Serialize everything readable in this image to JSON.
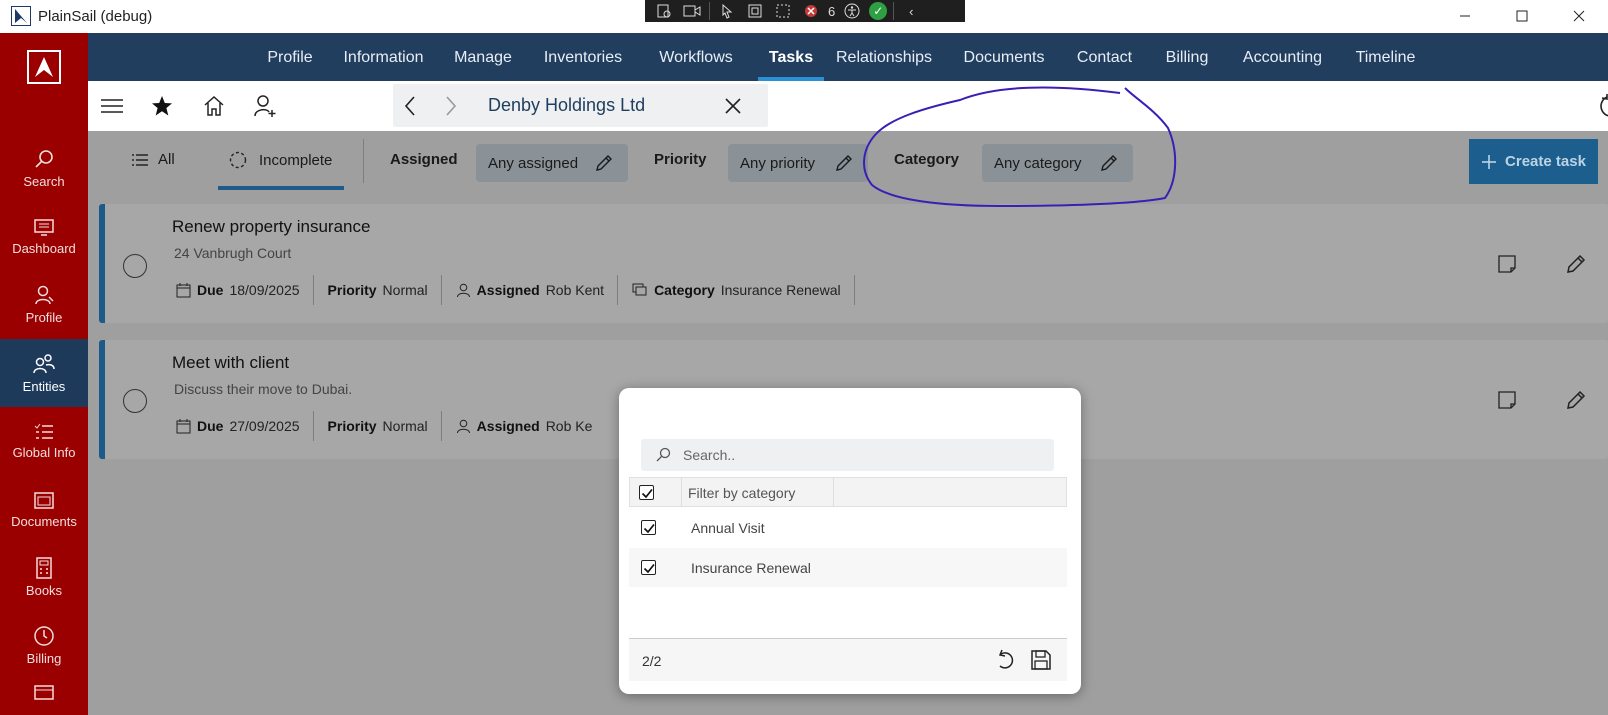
{
  "window": {
    "title": "PlainSail (debug)",
    "debug_badge_count": "6"
  },
  "sidebar": {
    "items": [
      {
        "label": "Search",
        "icon": "search-icon"
      },
      {
        "label": "Dashboard",
        "icon": "dashboard-icon"
      },
      {
        "label": "Profile",
        "icon": "profile-icon"
      },
      {
        "label": "Entities",
        "icon": "entities-icon",
        "active": true
      },
      {
        "label": "Global Info",
        "icon": "list-icon"
      },
      {
        "label": "Documents",
        "icon": "documents-icon"
      },
      {
        "label": "Books",
        "icon": "calculator-icon"
      },
      {
        "label": "Billing",
        "icon": "clock-icon"
      }
    ]
  },
  "topnav": {
    "tabs": [
      "Profile",
      "Information",
      "Manage",
      "Inventories",
      "Workflows",
      "Tasks",
      "Relationships",
      "Documents",
      "Contact",
      "Billing",
      "Accounting",
      "Timeline"
    ],
    "active": "Tasks"
  },
  "toolbar": {
    "entity_name": "Denby Holdings Ltd"
  },
  "filters": {
    "all_label": "All",
    "incomplete_label": "Incomplete",
    "assigned_label": "Assigned",
    "assigned_value": "Any assigned",
    "priority_label": "Priority",
    "priority_value": "Any priority",
    "category_label": "Category",
    "category_value": "Any category",
    "create_label": "Create task"
  },
  "tasks": [
    {
      "title": "Renew property insurance",
      "subtitle": "24 Vanbrugh Court",
      "due_label": "Due",
      "due": "18/09/2025",
      "priority_label": "Priority",
      "priority": "Normal",
      "assigned_label": "Assigned",
      "assigned": "Rob Kent",
      "category_label": "Category",
      "category": "Insurance Renewal"
    },
    {
      "title": "Meet with client",
      "subtitle": "Discuss their move to Dubai.",
      "due_label": "Due",
      "due": "27/09/2025",
      "priority_label": "Priority",
      "priority": "Normal",
      "assigned_label": "Assigned",
      "assigned": "Rob Ke"
    }
  ],
  "popup": {
    "search_placeholder": "Search..",
    "column_header": "Filter by category",
    "options": [
      {
        "label": "Annual Visit",
        "checked": true
      },
      {
        "label": "Insurance Renewal",
        "checked": true
      }
    ],
    "count": "2/2"
  },
  "colors": {
    "sidebar": "#9b0000",
    "topnav": "#213e5e",
    "accent": "#2b8fd6",
    "annotation": "#3a1fb5"
  }
}
